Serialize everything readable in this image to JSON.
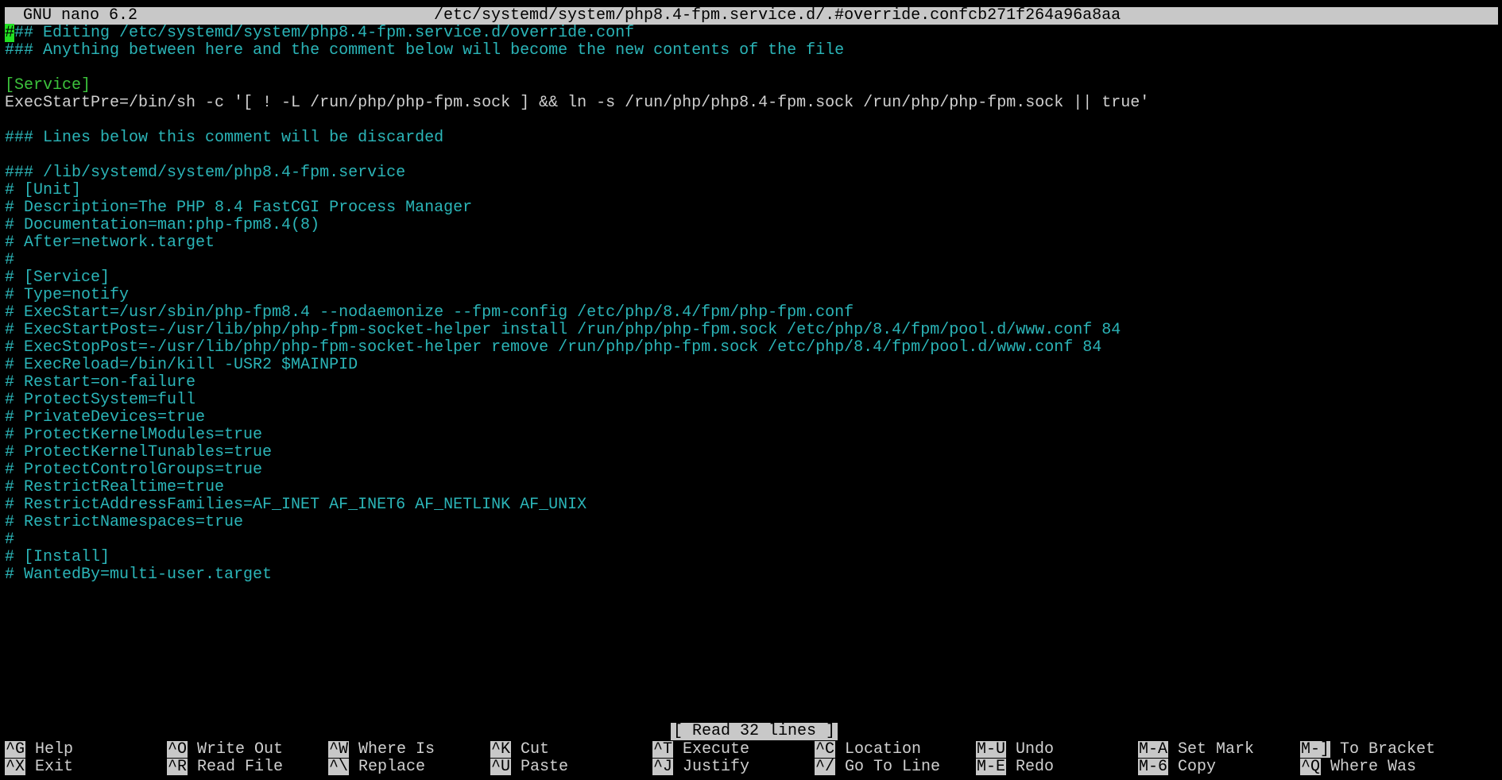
{
  "title_bar": {
    "app": "GNU nano 6.2",
    "file_path": "/etc/systemd/system/php8.4-fpm.service.d/.#override.confcb271f264a96a8aa"
  },
  "editor": {
    "cursor_char": "#",
    "line_1_rest": "## Editing /etc/systemd/system/php8.4-fpm.service.d/override.conf",
    "line_2": "### Anything between here and the comment below will become the new contents of the file",
    "line_4": "[Service]",
    "line_5": "ExecStartPre=/bin/sh -c '[ ! -L /run/php/php-fpm.sock ] && ln -s /run/php/php8.4-fpm.sock /run/php/php-fpm.sock || true'",
    "line_7": "### Lines below this comment will be discarded",
    "line_9": "### /lib/systemd/system/php8.4-fpm.service",
    "line_10": "# [Unit]",
    "line_11": "# Description=The PHP 8.4 FastCGI Process Manager",
    "line_12": "# Documentation=man:php-fpm8.4(8)",
    "line_13": "# After=network.target",
    "line_14": "#",
    "line_15": "# [Service]",
    "line_16": "# Type=notify",
    "line_17": "# ExecStart=/usr/sbin/php-fpm8.4 --nodaemonize --fpm-config /etc/php/8.4/fpm/php-fpm.conf",
    "line_18": "# ExecStartPost=-/usr/lib/php/php-fpm-socket-helper install /run/php/php-fpm.sock /etc/php/8.4/fpm/pool.d/www.conf 84",
    "line_19": "# ExecStopPost=-/usr/lib/php/php-fpm-socket-helper remove /run/php/php-fpm.sock /etc/php/8.4/fpm/pool.d/www.conf 84",
    "line_20": "# ExecReload=/bin/kill -USR2 $MAINPID",
    "line_21": "# Restart=on-failure",
    "line_22": "# ProtectSystem=full",
    "line_23": "# PrivateDevices=true",
    "line_24": "# ProtectKernelModules=true",
    "line_25": "# ProtectKernelTunables=true",
    "line_26": "# ProtectControlGroups=true",
    "line_27": "# RestrictRealtime=true",
    "line_28": "# RestrictAddressFamilies=AF_INET AF_INET6 AF_NETLINK AF_UNIX",
    "line_29": "# RestrictNamespaces=true",
    "line_30": "#",
    "line_31": "# [Install]",
    "line_32": "# WantedBy=multi-user.target"
  },
  "status_message": "[ Read 32 lines ]",
  "shortcuts": {
    "help": {
      "key": "^G",
      "label": "Help"
    },
    "exit": {
      "key": "^X",
      "label": "Exit"
    },
    "write_out": {
      "key": "^O",
      "label": "Write Out"
    },
    "read_file": {
      "key": "^R",
      "label": "Read File"
    },
    "where_is": {
      "key": "^W",
      "label": "Where Is"
    },
    "replace": {
      "key": "^\\",
      "label": "Replace"
    },
    "cut": {
      "key": "^K",
      "label": "Cut"
    },
    "paste": {
      "key": "^U",
      "label": "Paste"
    },
    "execute": {
      "key": "^T",
      "label": "Execute"
    },
    "justify": {
      "key": "^J",
      "label": "Justify"
    },
    "location": {
      "key": "^C",
      "label": "Location"
    },
    "go_to_line": {
      "key": "^/",
      "label": "Go To Line"
    },
    "undo": {
      "key": "M-U",
      "label": "Undo"
    },
    "redo": {
      "key": "M-E",
      "label": "Redo"
    },
    "set_mark": {
      "key": "M-A",
      "label": "Set Mark"
    },
    "copy": {
      "key": "M-6",
      "label": "Copy"
    },
    "to_bracket": {
      "key": "M-]",
      "label": "To Bracket"
    },
    "where_was": {
      "key": "^Q",
      "label": "Where Was"
    }
  },
  "colors": {
    "background": "#000000",
    "comment": "#2bb5b8",
    "section": "#3cc33c",
    "text": "#d0d0d0",
    "bar": "#c8c8c8",
    "cursor": "#22e022"
  }
}
